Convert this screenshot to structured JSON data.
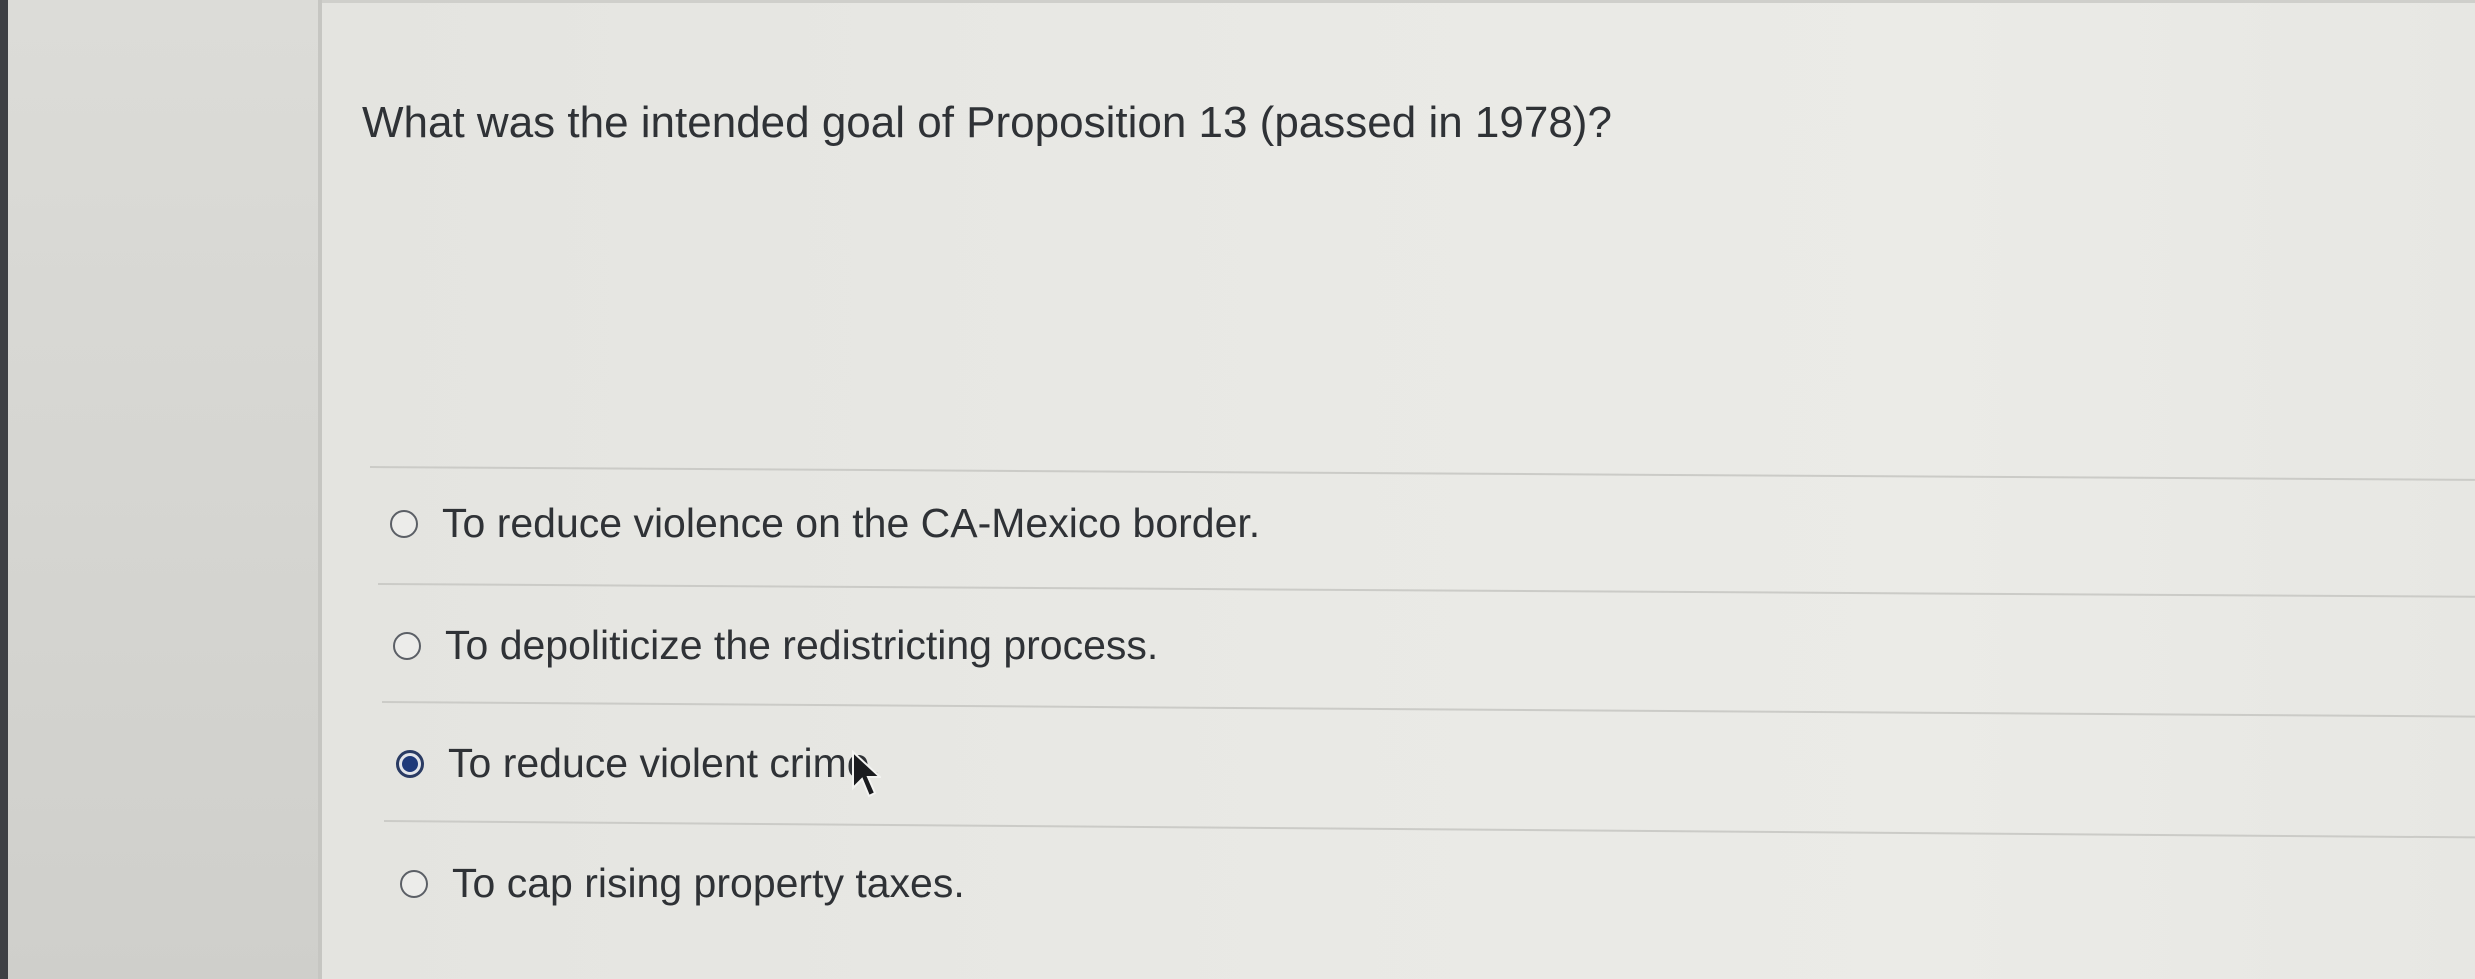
{
  "question": {
    "text": "What was the intended goal of Proposition 13 (passed in 1978)?"
  },
  "options": [
    {
      "label": "To reduce violence on the CA-Mexico border.",
      "selected": false
    },
    {
      "label": "To depoliticize the redistricting process.",
      "selected": false
    },
    {
      "label": "To reduce violent crime.",
      "selected": true
    },
    {
      "label": "To cap rising property taxes.",
      "selected": false
    }
  ],
  "colors": {
    "selected_radio": "#1f3a7a",
    "text": "#2f3236",
    "background": "#e9e9e5"
  },
  "icons": {
    "cursor": "arrow-pointer-icon"
  }
}
